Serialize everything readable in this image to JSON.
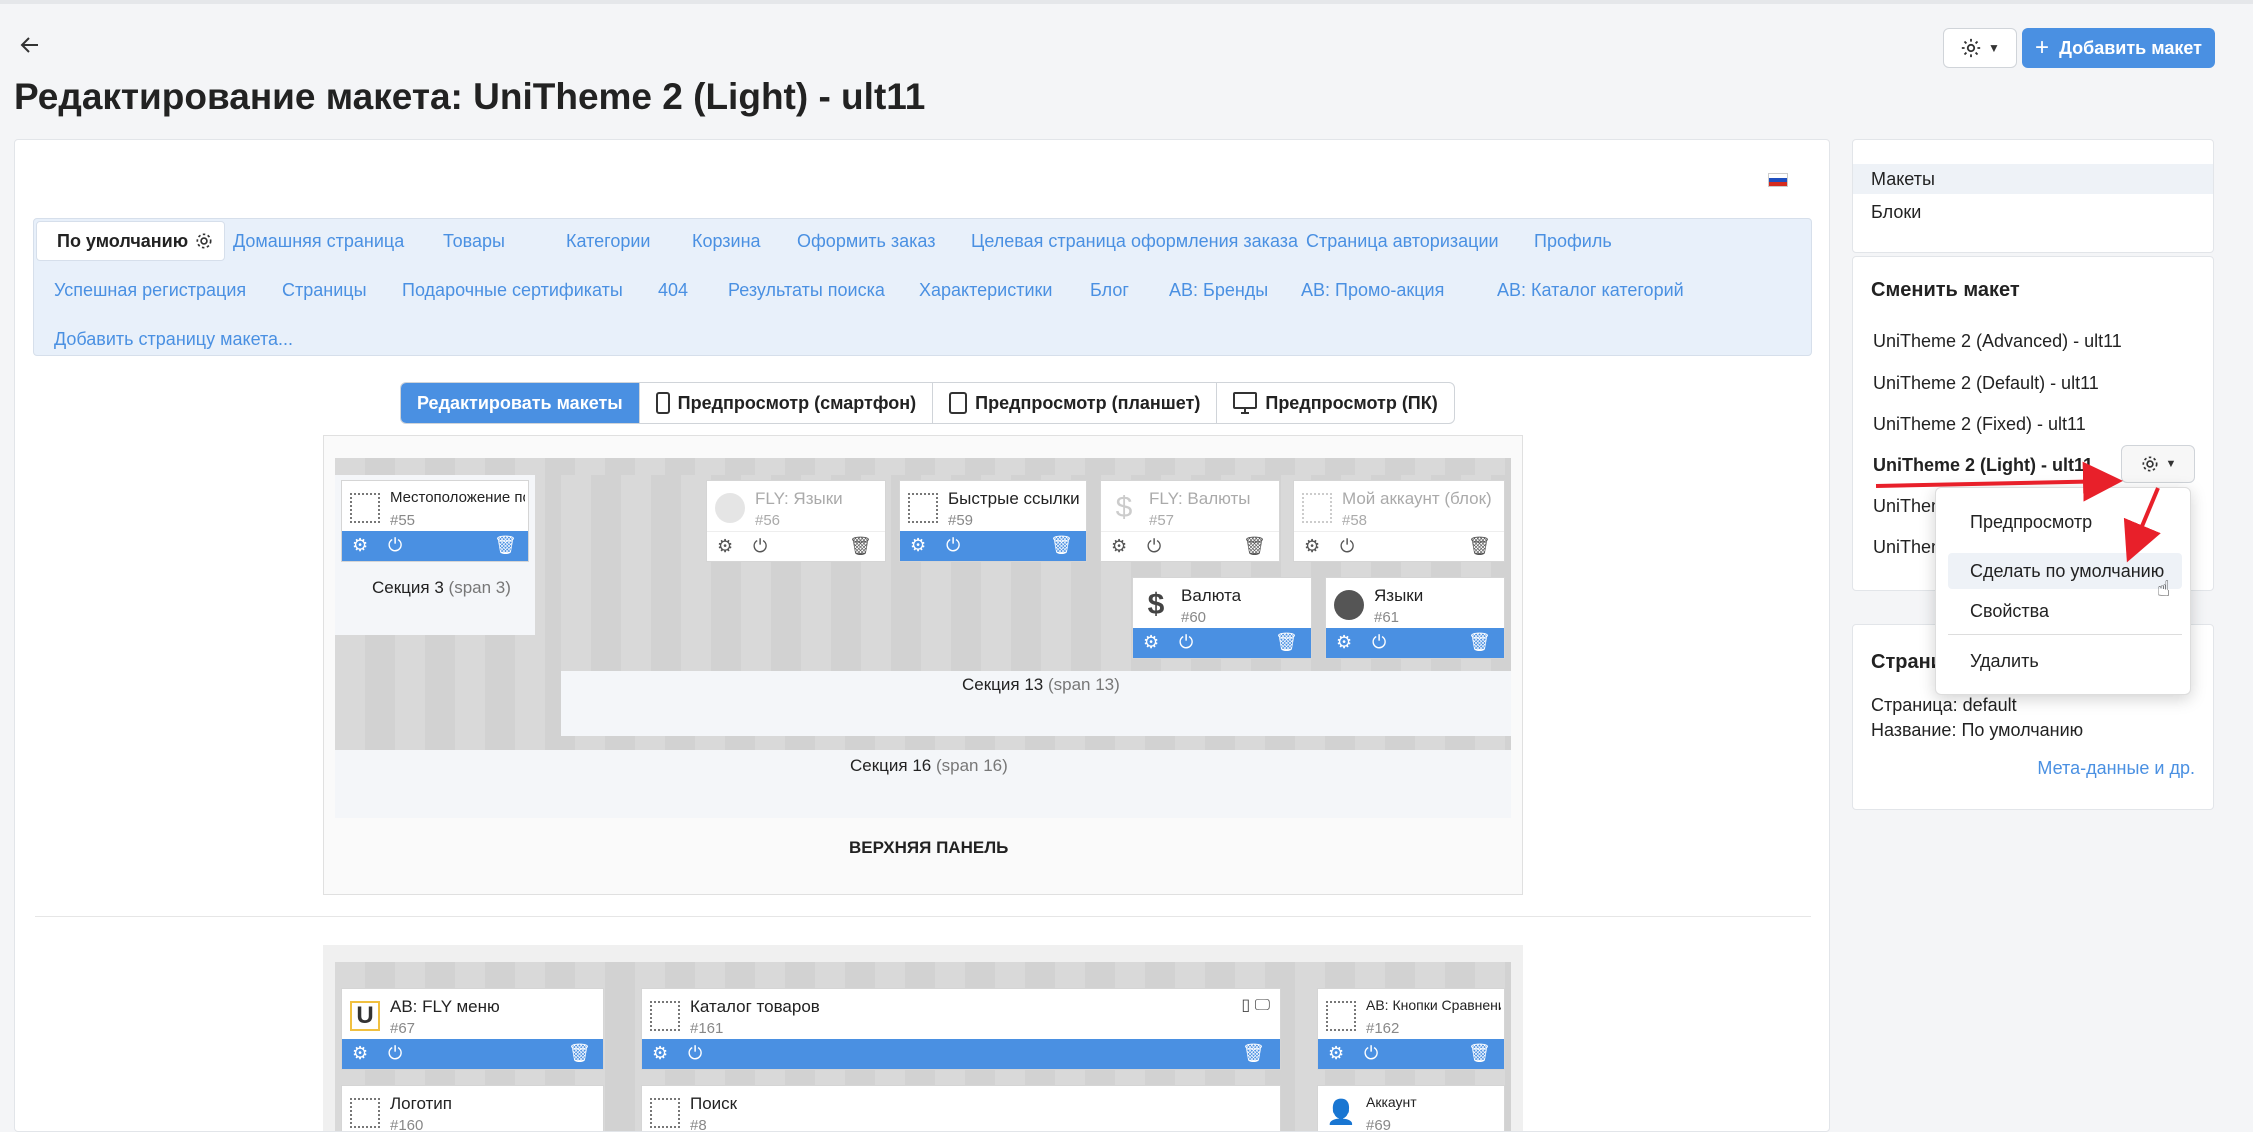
{
  "header": {
    "title": "Редактирование макета: UniTheme 2 (Light) - ult11",
    "add_button": "Добавить макет"
  },
  "tabs": {
    "active": "По умолчанию",
    "row1": [
      "Домашняя страница",
      "Товары",
      "Категории",
      "Корзина",
      "Оформить заказ",
      "Целевая страница оформления заказа",
      "Страница авторизации",
      "Профиль"
    ],
    "row2": [
      "Успешная регистрация",
      "Страницы",
      "Подарочные сертификаты",
      "404",
      "Результаты поиска",
      "Характеристики",
      "Блог",
      "AB: Бренды",
      "AB: Промо-акция",
      "AB: Каталог категорий"
    ],
    "add": "Добавить страницу макета..."
  },
  "modes": [
    "Редактировать макеты",
    "Предпросмотр (смартфон)",
    "Предпросмотр (планшет)",
    "Предпросмотр (ПК)"
  ],
  "blocks": {
    "b55": {
      "name": "Местоположение по",
      "id": "#55"
    },
    "b56": {
      "name": "FLY: Языки",
      "id": "#56"
    },
    "b59": {
      "name": "Быстрые ссылки",
      "id": "#59"
    },
    "b57": {
      "name": "FLY: Валюты",
      "id": "#57"
    },
    "b58": {
      "name": "Мой аккаунт (блок)",
      "id": "#58"
    },
    "b60": {
      "name": "Валюта",
      "id": "#60"
    },
    "b61": {
      "name": "Языки",
      "id": "#61"
    },
    "b67": {
      "name": "AB: FLY меню",
      "id": "#67"
    },
    "b161": {
      "name": "Каталог товаров",
      "id": "#161"
    },
    "b162": {
      "name": "AB: Кнопки Сравнения",
      "id": "#162"
    },
    "b160": {
      "name": "Логотип",
      "id": "#160"
    },
    "b8": {
      "name": "Поиск",
      "id": "#8"
    },
    "b69": {
      "name": "Аккаунт",
      "id": "#69"
    }
  },
  "sections": {
    "s3": {
      "name": "Секция 3",
      "span": "(span 3)"
    },
    "s13": {
      "name": "Секция 13",
      "span": "(span 13)"
    },
    "s16": {
      "name": "Секция 16",
      "span": "(span 16)"
    },
    "top_panel": "ВЕРХНЯЯ ПАНЕЛЬ"
  },
  "sidebar": {
    "nav": [
      "Макеты",
      "Блоки"
    ],
    "switch_title": "Сменить макет",
    "layouts": [
      "UniTheme 2 (Advanced) - ult11",
      "UniTheme 2 (Default) - ult11",
      "UniTheme 2 (Fixed) - ult11",
      "UniTheme 2 (Light) - ult11",
      "UniThem",
      "UniThem"
    ],
    "page_title": "Страни",
    "page_line": "Страница: default",
    "name_line": "Название: По умолчанию",
    "meta_link": "Мета-данные и др."
  },
  "dropdown": [
    "Предпросмотр",
    "Сделать по умолчанию",
    "Свойства",
    "Удалить"
  ],
  "colors": {
    "accent": "#4a90e2",
    "arrow": "#e8202a"
  }
}
